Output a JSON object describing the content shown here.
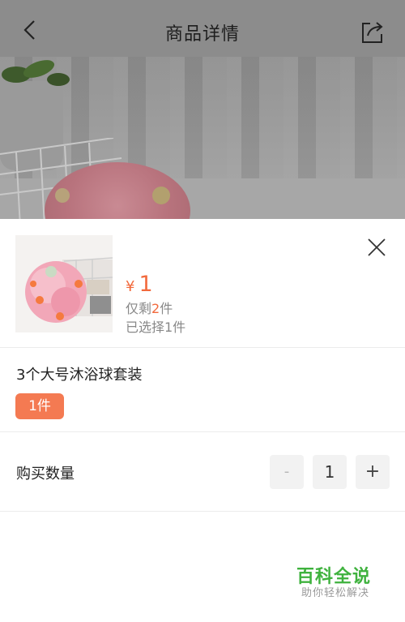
{
  "header": {
    "title": "商品详情",
    "back_icon": "chevron-left-icon",
    "share_icon": "share-icon"
  },
  "product": {
    "currency": "¥",
    "price": "1",
    "stock_prefix": "仅剩",
    "stock_count": "2",
    "stock_suffix": "件",
    "selected_text": "已选择1件"
  },
  "spec": {
    "title": "3个大号沐浴球套装",
    "option": "1件"
  },
  "quantity": {
    "label": "购买数量",
    "minus": "-",
    "value": "1",
    "plus": "+"
  },
  "watermark": {
    "title": "百科全说",
    "subtitle": "助你轻松解决"
  },
  "colors": {
    "accent": "#f26a3d",
    "chip": "#f47a52",
    "watermark_green": "#3fb23e"
  }
}
